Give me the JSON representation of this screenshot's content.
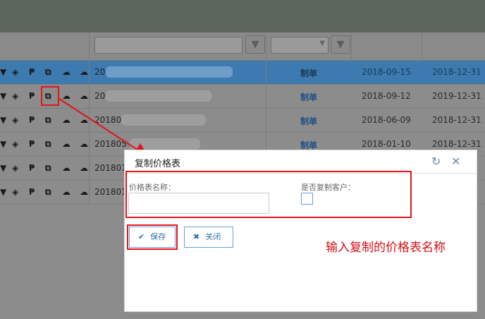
{
  "filters": {
    "code_filter_value": "",
    "status_filter_value": ""
  },
  "rows": [
    {
      "code": "20",
      "status": "制单",
      "start_date": "2018-09-15",
      "end_date": "2018-12-31",
      "selected": true
    },
    {
      "code": "20",
      "status": "制单",
      "start_date": "2018-09-12",
      "end_date": "2019-12-31",
      "selected": false
    },
    {
      "code": "20180",
      "status": "制单",
      "start_date": "2018-06-09",
      "end_date": "2018-12-31",
      "selected": false
    },
    {
      "code": "201805",
      "status": "制单",
      "start_date": "2018-01-10",
      "end_date": "2018-12-31",
      "selected": false
    },
    {
      "code": "201801",
      "status": "",
      "start_date": "",
      "end_date": "",
      "selected": false
    },
    {
      "code": "201801",
      "status": "",
      "start_date": "",
      "end_date": "",
      "selected": false
    }
  ],
  "row_icons": [
    "shield-icon",
    "pin-icon",
    "copy-icon",
    "cloud-icon",
    "cloud-download-icon"
  ],
  "dialog": {
    "title": "复制价格表",
    "refresh_glyph": "↻",
    "close_glyph": "✕",
    "name_label": "价格表名称：",
    "name_value": "",
    "name_placeholder": "",
    "copy_customer_label": "是否复制客户：",
    "copy_customer_checked": false,
    "save_label": "保存",
    "close_label": "关闭"
  },
  "annotation": {
    "hint_text": "输入复制的价格表名称",
    "color": "#e0141b"
  }
}
